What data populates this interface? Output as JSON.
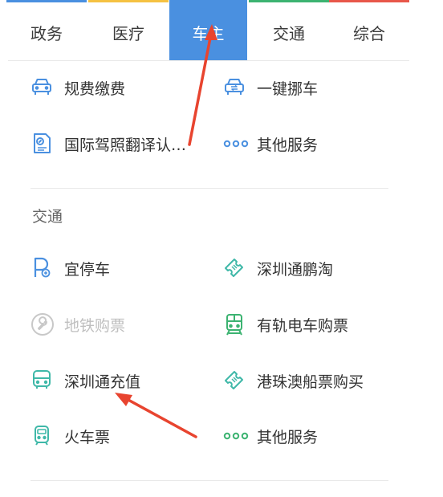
{
  "tabs": [
    {
      "label": "政务",
      "bar_color": "#4a90e0"
    },
    {
      "label": "医疗",
      "bar_color": "#f5c242"
    },
    {
      "label": "车主",
      "bar_color": "#4a90e0"
    },
    {
      "label": "交通",
      "bar_color": "#3cb371"
    },
    {
      "label": "综合",
      "bar_color": "#e8574a"
    }
  ],
  "active_tab": "车主",
  "owner_section": {
    "items": [
      {
        "label": "规费缴费",
        "icon": "car-icon"
      },
      {
        "label": "一键挪车",
        "icon": "car-swap-icon"
      },
      {
        "label": "国际驾照翻译认…",
        "icon": "license-document-icon"
      },
      {
        "label": "其他服务",
        "icon": "more-dots-icon"
      }
    ]
  },
  "traffic_section": {
    "title": "交通",
    "items": [
      {
        "label": "宜停车",
        "icon": "parking-icon"
      },
      {
        "label": "深圳通鹏淘",
        "icon": "ticket-icon"
      },
      {
        "label": "地铁购票",
        "icon": "wrench-icon"
      },
      {
        "label": "有轨电车购票",
        "icon": "tram-icon"
      },
      {
        "label": "深圳通充值",
        "icon": "bus-icon"
      },
      {
        "label": "港珠澳船票购买",
        "icon": "ticket-icon"
      },
      {
        "label": "火车票",
        "icon": "train-icon"
      },
      {
        "label": "其他服务",
        "icon": "more-dots-icon"
      }
    ]
  },
  "colors": {
    "accent_blue": "#4a90e0",
    "icon_blue": "#4a90e0",
    "icon_green": "#3cb371",
    "icon_teal": "#3fb8a8",
    "annotation_red": "#e8442f"
  }
}
